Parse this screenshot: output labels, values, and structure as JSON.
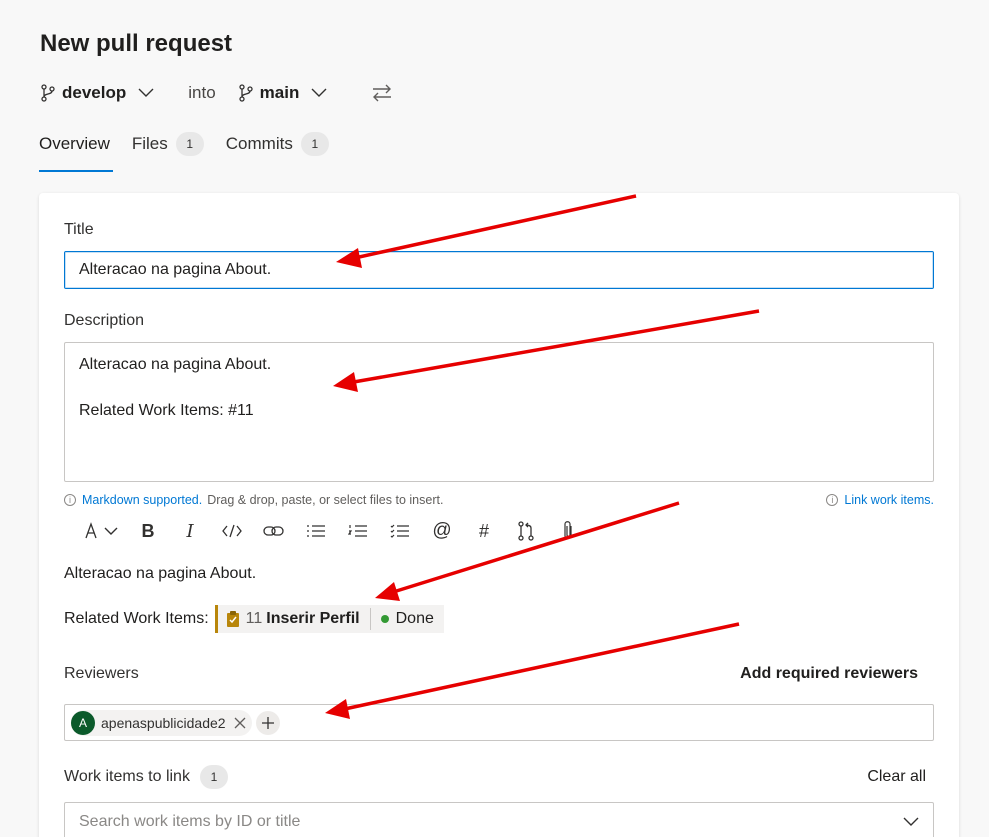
{
  "header": {
    "title": "New pull request",
    "source_branch": "develop",
    "into_label": "into",
    "target_branch": "main"
  },
  "tabs": [
    {
      "label": "Overview"
    },
    {
      "label": "Files",
      "count": "1"
    },
    {
      "label": "Commits",
      "count": "1"
    }
  ],
  "form": {
    "title_label": "Title",
    "title_value": "Alteracao na pagina About.",
    "description_label": "Description",
    "description_line1": "Alteracao na pagina About.",
    "description_line2": "Related Work Items: #11",
    "markdown_link": "Markdown supported.",
    "markdown_hint": "Drag & drop, paste, or select files to insert.",
    "link_work_items": "Link work items."
  },
  "preview": {
    "text": "Alteracao na pagina About.",
    "related_label": "Related Work Items:",
    "work_item_id": "11",
    "work_item_name": "Inserir Perfil",
    "work_item_state": "Done"
  },
  "reviewers": {
    "label": "Reviewers",
    "add_required": "Add required reviewers",
    "reviewer_initial": "A",
    "reviewer_name": "apenaspublicidade2"
  },
  "work_items": {
    "label": "Work items to link",
    "count": "1",
    "clear_all": "Clear all",
    "search_placeholder": "Search work items by ID or title"
  },
  "colors": {
    "accent": "#0078d4",
    "annotation_arrow": "#e60000",
    "done_status": "#339933",
    "avatar_bg": "#0b5a2b"
  }
}
